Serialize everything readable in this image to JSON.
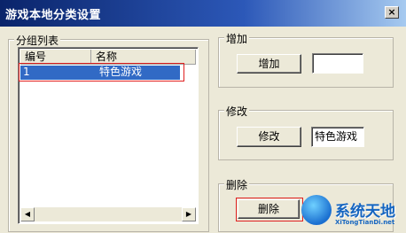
{
  "window": {
    "title": "游戏本地分类设置",
    "close_label": "×"
  },
  "group_list": {
    "legend": "分组列表",
    "columns": [
      "编号",
      "名称"
    ],
    "rows": [
      {
        "id": "1",
        "name": "特色游戏"
      }
    ],
    "scroll_left": "◀",
    "scroll_right": "▶"
  },
  "add_group": {
    "legend": "增加",
    "button": "增加",
    "input_value": ""
  },
  "edit_group": {
    "legend": "修改",
    "button": "修改",
    "input_value": "特色游戏"
  },
  "delete_group": {
    "legend": "删除",
    "button": "删除"
  },
  "watermark": {
    "main": "系统天地",
    "sub": "XiTongTianDi.net"
  },
  "colors": {
    "selection": "#316AC5",
    "highlight_box": "#E02020",
    "face": "#ECE9D8"
  }
}
